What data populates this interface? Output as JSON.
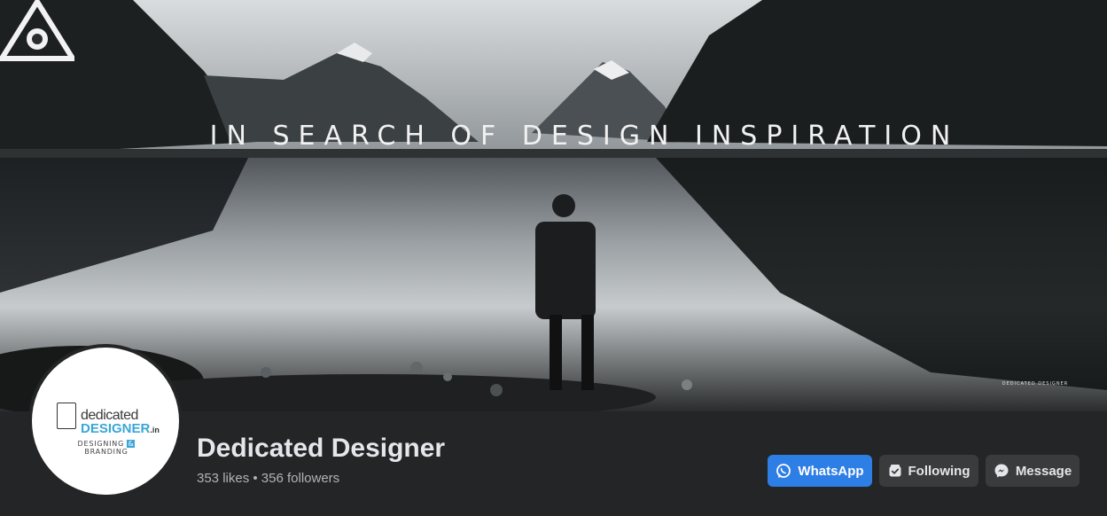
{
  "cover": {
    "headline": "IN SEARCH OF DESIGN INSPIRATION",
    "corner_logo_text": "DEDICATED DESIGNER"
  },
  "avatar": {
    "logo_line1": "dedicated",
    "logo_line2": "DESIGNER",
    "logo_suffix": ".in",
    "tagline_left": "DESIGNING",
    "tagline_amp": "&",
    "tagline_right": "BRANDING"
  },
  "page": {
    "name": "Dedicated Designer",
    "stats": "353 likes • 356 followers"
  },
  "actions": {
    "whatsapp_label": "WhatsApp",
    "following_label": "Following",
    "message_label": "Message"
  },
  "colors": {
    "background": "#242526",
    "primary_button": "#2d7ee5",
    "secondary_button": "#3a3b3c",
    "name_text": "#e4e6eb",
    "muted_text": "#b0b3b8"
  },
  "icons": {
    "whatsapp": "whatsapp-icon",
    "following": "following-icon",
    "message": "messenger-icon"
  }
}
